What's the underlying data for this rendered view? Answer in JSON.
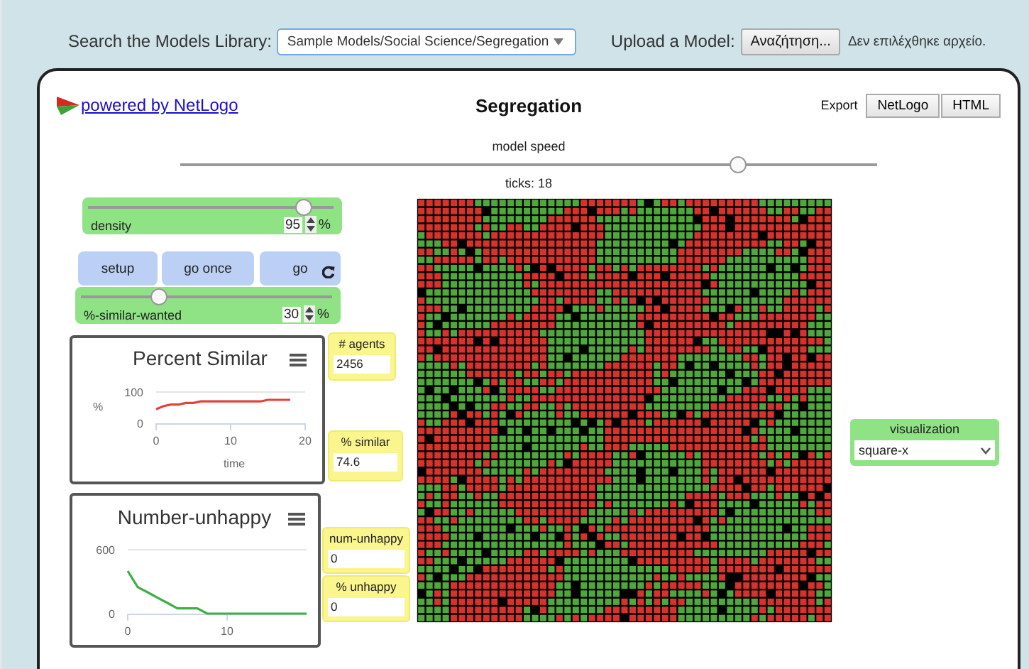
{
  "header": {
    "library_label": "Search the Models Library:",
    "library_value": "Sample Models/Social Science/Segregation",
    "upload_label": "Upload a Model:",
    "browse_button": "Αναζήτηση...",
    "no_file_text": "Δεν επιλέχθηκε αρχείο."
  },
  "model": {
    "powered_by": "powered by NetLogo",
    "title": "Segregation",
    "export_label": "Export",
    "export_buttons": [
      "NetLogo",
      "HTML"
    ],
    "speed_label": "model speed",
    "speed": {
      "level": 0.8
    },
    "ticks": "ticks: 18"
  },
  "sliders": [
    {
      "label": "density",
      "value": "95",
      "unit": "%",
      "level": 0.88
    },
    {
      "label": "%-similar-wanted",
      "value": "30",
      "unit": "%",
      "level": 0.31
    }
  ],
  "buttons": [
    {
      "label": "setup",
      "forever": false
    },
    {
      "label": "go once",
      "forever": false
    },
    {
      "label": "go",
      "forever": true
    }
  ],
  "monitors": [
    {
      "label": "# agents",
      "value": "2456"
    },
    {
      "label": "% similar",
      "value": "74.6"
    },
    {
      "label": "num-unhappy",
      "value": "0"
    },
    {
      "label": "% unhappy",
      "value": "0"
    }
  ],
  "plots": [
    {
      "chart_data": {
        "type": "line",
        "title": "Percent Similar",
        "xlabel": "time",
        "ylabel": "%",
        "xlim": [
          0,
          20
        ],
        "ylim": [
          0,
          100
        ],
        "xticks": [
          0,
          10,
          20
        ],
        "yticks": [
          0,
          100
        ],
        "x": [
          0,
          1,
          2,
          3,
          4,
          5,
          6,
          7,
          8,
          9,
          10,
          11,
          12,
          13,
          14,
          15,
          16,
          17,
          18
        ],
        "series": [
          {
            "color": "#e5413a",
            "values": [
              45,
              55,
              60,
              60,
              65,
              65,
              70,
              70,
              70,
              70,
              70,
              70,
              70,
              70,
              70,
              75,
              75,
              75,
              75
            ]
          }
        ]
      }
    },
    {
      "chart_data": {
        "type": "line",
        "title": "Number-unhappy",
        "xlim": [
          0,
          18
        ],
        "ylim": [
          0,
          600
        ],
        "xticks": [
          0,
          10
        ],
        "yticks": [
          0,
          600
        ],
        "x": [
          0,
          1,
          2,
          3,
          4,
          5,
          6,
          7,
          8,
          9,
          10,
          11,
          12,
          13,
          14,
          15,
          16,
          17,
          18
        ],
        "series": [
          {
            "color": "#3cb043",
            "values": [
              400,
              250,
              200,
              150,
              100,
              50,
              50,
              50,
              0,
              0,
              0,
              0,
              0,
              0,
              0,
              0,
              0,
              0,
              0
            ]
          }
        ]
      }
    }
  ],
  "chooser": {
    "label": "visualization",
    "value": "square-x"
  }
}
